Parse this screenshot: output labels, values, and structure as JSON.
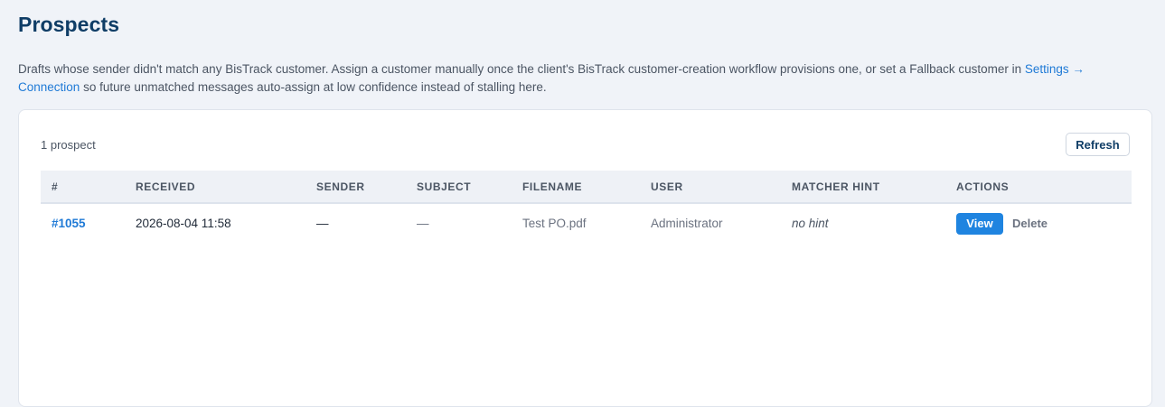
{
  "page": {
    "title": "Prospects",
    "description": {
      "text_before": "Drafts whose sender didn't match any BisTrack customer. Assign a customer manually once the client's BisTrack customer-creation workflow provisions one, or set a Fallback customer in ",
      "link_text": "Settings → Connection",
      "text_after": " so future unmatched messages auto-assign at low confidence instead of stalling here."
    }
  },
  "toolbar": {
    "count_label": "1 prospect",
    "refresh_label": "Refresh"
  },
  "table": {
    "headers": {
      "id": "#",
      "received": "RECEIVED",
      "sender": "SENDER",
      "subject": "SUBJECT",
      "filename": "FILENAME",
      "user": "USER",
      "matcher_hint": "MATCHER HINT",
      "actions": "ACTIONS"
    },
    "rows": [
      {
        "id": "#1055",
        "received": "2026-08-04 11:58",
        "sender": "—",
        "subject": "—",
        "filename": "Test PO.pdf",
        "user": "Administrator",
        "matcher_hint": "no hint",
        "view_label": "View",
        "delete_label": "Delete"
      }
    ]
  },
  "colors": {
    "page_background": "#f0f3f8",
    "title": "#0f3d66",
    "link": "#1f7ad6",
    "primary_button": "#1f84e0",
    "table_header_background": "#eef1f6"
  }
}
